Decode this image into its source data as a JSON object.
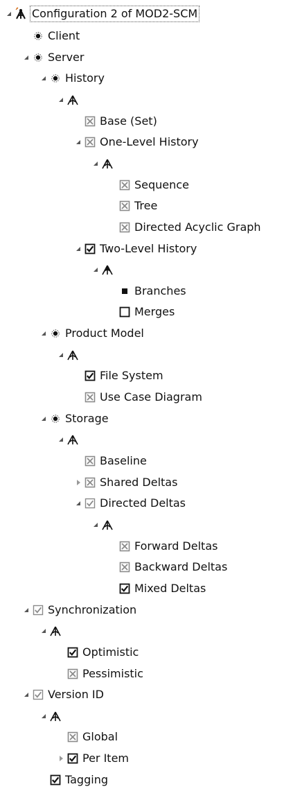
{
  "tree": {
    "root": {
      "label": "Configuration 2 of MOD2-SCM",
      "icon": "feature-model-root-icon"
    },
    "rows": [
      {
        "label": "Client",
        "icon": "bullet-icon",
        "expander": "none",
        "level": 1
      },
      {
        "label": "Server",
        "icon": "bullet-icon",
        "expander": "expanded",
        "level": 1
      },
      {
        "label": "History",
        "icon": "bullet-icon",
        "expander": "expanded",
        "level": 2
      },
      {
        "label": "",
        "icon": "alternative-group-icon",
        "expander": "expanded",
        "level": 3
      },
      {
        "label": "Base (Set)",
        "icon": "checkbox-crossed-icon",
        "expander": "none",
        "level": 4
      },
      {
        "label": "One-Level History",
        "icon": "checkbox-crossed-icon",
        "expander": "expanded",
        "level": 4
      },
      {
        "label": "",
        "icon": "alternative-group-icon",
        "expander": "expanded",
        "level": 5
      },
      {
        "label": "Sequence",
        "icon": "checkbox-crossed-icon",
        "expander": "none",
        "level": 6
      },
      {
        "label": "Tree",
        "icon": "checkbox-crossed-icon",
        "expander": "none",
        "level": 6
      },
      {
        "label": "Directed Acyclic Graph",
        "icon": "checkbox-crossed-icon",
        "expander": "none",
        "level": 6
      },
      {
        "label": "Two-Level History",
        "icon": "checkbox-checked-icon",
        "expander": "expanded",
        "level": 4
      },
      {
        "label": "",
        "icon": "or-group-icon",
        "expander": "expanded",
        "level": 5
      },
      {
        "label": "Branches",
        "icon": "checkbox-partial-icon",
        "expander": "none",
        "level": 6
      },
      {
        "label": "Merges",
        "icon": "checkbox-empty-icon",
        "expander": "none",
        "level": 6
      },
      {
        "label": "Product Model",
        "icon": "bullet-icon",
        "expander": "expanded",
        "level": 2
      },
      {
        "label": "",
        "icon": "alternative-group-icon",
        "expander": "expanded",
        "level": 3
      },
      {
        "label": "File System",
        "icon": "checkbox-checked-icon",
        "expander": "none",
        "level": 4
      },
      {
        "label": "Use Case Diagram",
        "icon": "checkbox-crossed-icon",
        "expander": "none",
        "level": 4
      },
      {
        "label": "Storage",
        "icon": "bullet-icon",
        "expander": "expanded",
        "level": 2
      },
      {
        "label": "",
        "icon": "alternative-group-icon",
        "expander": "expanded",
        "level": 3
      },
      {
        "label": "Baseline",
        "icon": "checkbox-crossed-icon",
        "expander": "none",
        "level": 4
      },
      {
        "label": "Shared Deltas",
        "icon": "checkbox-crossed-icon",
        "expander": "collapsed",
        "level": 4
      },
      {
        "label": "Directed Deltas",
        "icon": "checkbox-checked-gray-icon",
        "expander": "expanded",
        "level": 4
      },
      {
        "label": "",
        "icon": "alternative-group-icon",
        "expander": "expanded",
        "level": 5
      },
      {
        "label": "Forward Deltas",
        "icon": "checkbox-crossed-icon",
        "expander": "none",
        "level": 6
      },
      {
        "label": "Backward Deltas",
        "icon": "checkbox-crossed-icon",
        "expander": "none",
        "level": 6
      },
      {
        "label": "Mixed Deltas",
        "icon": "checkbox-checked-icon",
        "expander": "none",
        "level": 6
      },
      {
        "label": "Synchronization",
        "icon": "checkbox-checked-gray-icon",
        "expander": "expanded",
        "level": 1
      },
      {
        "label": "",
        "icon": "alternative-group-icon",
        "expander": "expanded",
        "level": 2
      },
      {
        "label": "Optimistic",
        "icon": "checkbox-checked-icon",
        "expander": "none",
        "level": 3
      },
      {
        "label": "Pessimistic",
        "icon": "checkbox-crossed-icon",
        "expander": "none",
        "level": 3
      },
      {
        "label": "Version ID",
        "icon": "checkbox-checked-gray-icon",
        "expander": "expanded",
        "level": 1
      },
      {
        "label": "",
        "icon": "alternative-group-icon",
        "expander": "expanded",
        "level": 2
      },
      {
        "label": "Global",
        "icon": "checkbox-crossed-icon",
        "expander": "none",
        "level": 3
      },
      {
        "label": "Per Item",
        "icon": "checkbox-checked-icon",
        "expander": "collapsed",
        "level": 3
      },
      {
        "label": "Tagging",
        "icon": "checkbox-checked-icon",
        "expander": "none",
        "level": 2
      }
    ]
  },
  "colors": {
    "text": "#111111",
    "crossed": "#8a8a8a",
    "checked": "#111111",
    "checked_gray": "#8a8a8a",
    "expander": "#555555"
  }
}
